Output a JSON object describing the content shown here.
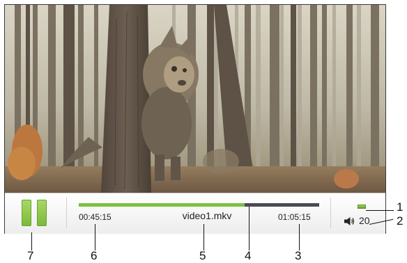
{
  "player": {
    "file_name": "video1.mkv",
    "time_elapsed": "00:45:15",
    "time_total": "01:05:15",
    "progress_fraction": 0.69,
    "volume_value": "20",
    "volume_level_fraction": 0.2,
    "playback_state": "playing",
    "pause_icon": "pause-icon",
    "speaker_icon": "speaker-icon",
    "accent_color": "#7cc140"
  },
  "callouts": {
    "c1": "1",
    "c2": "2",
    "c3": "3",
    "c4": "4",
    "c5": "5",
    "c6": "6",
    "c7": "7"
  }
}
